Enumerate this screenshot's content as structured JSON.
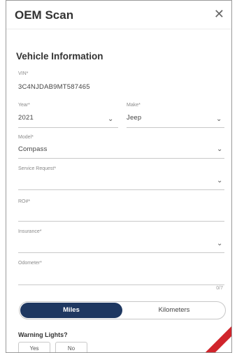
{
  "header": {
    "title": "OEM Scan",
    "close_icon": "close-icon"
  },
  "section": {
    "title": "Vehicle Information"
  },
  "fields": {
    "vin": {
      "label": "VIN*",
      "value": "3C4NJDAB9MT587465"
    },
    "year": {
      "label": "Year*",
      "value": "2021"
    },
    "make": {
      "label": "Make*",
      "value": "Jeep"
    },
    "model": {
      "label": "Model*",
      "value": "Compass"
    },
    "service_request": {
      "label": "Service Request*",
      "value": ""
    },
    "ro": {
      "label": "RO#*",
      "value": ""
    },
    "insurance": {
      "label": "Insurance*",
      "value": ""
    },
    "odometer": {
      "label": "Odometer*",
      "value": "",
      "counter": "0/7"
    }
  },
  "units": {
    "options": [
      "Miles",
      "Kilometers"
    ],
    "selected": "Miles"
  },
  "warning": {
    "label": "Warning Lights?",
    "yes": "Yes",
    "no": "No"
  },
  "colors": {
    "accent": "#1f3861",
    "ribbon": "#d0242b"
  }
}
